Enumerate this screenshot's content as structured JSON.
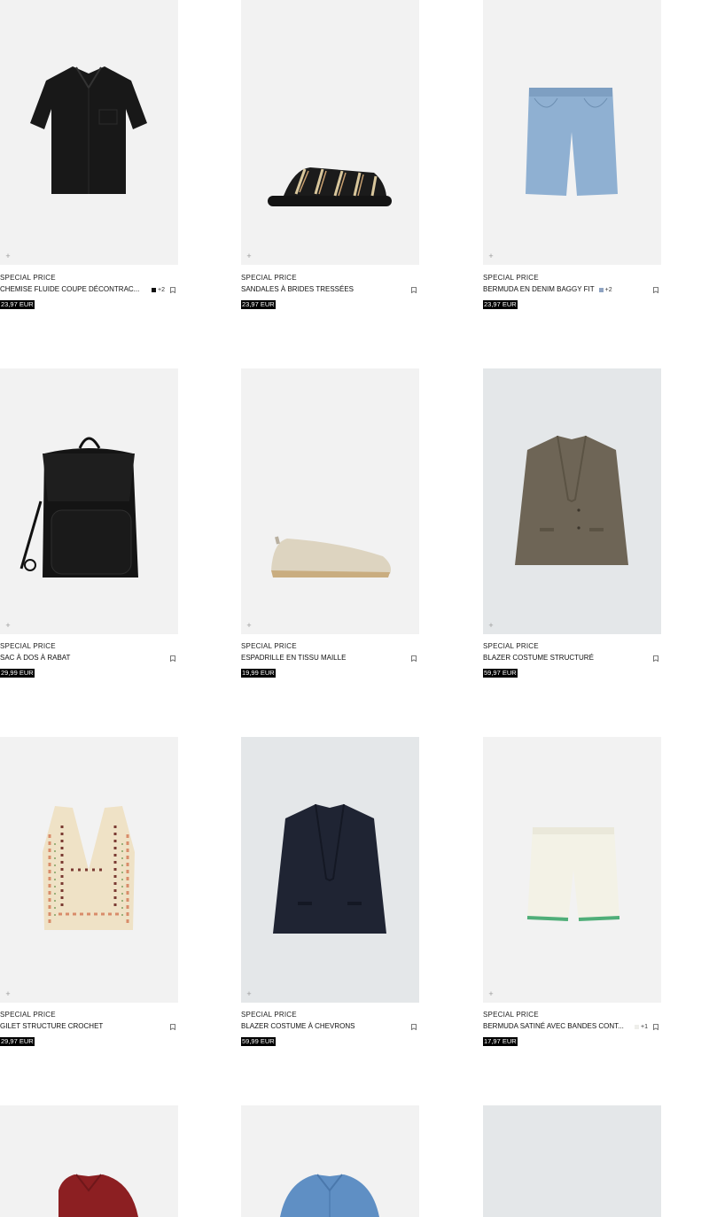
{
  "products": [
    {
      "tag": "SPECIAL PRICE",
      "name": "CHEMISE FLUIDE COUPE DÉCONTRAC...",
      "swatch_color": "#111111",
      "more": "+2",
      "price": "23,97 EUR",
      "icon": "black-shirt-icon",
      "bg": "#f2f2f2"
    },
    {
      "tag": "SPECIAL PRICE",
      "name": "SANDALES À BRIDES TRESSÉES",
      "swatch_color": "",
      "more": "",
      "price": "23,97 EUR",
      "icon": "woven-sandal-icon",
      "bg": "#f2f2f2"
    },
    {
      "tag": "SPECIAL PRICE",
      "name": "BERMUDA EN DENIM BAGGY FIT",
      "swatch_color": "#8ea3c2",
      "more": "+2",
      "price": "23,97 EUR",
      "icon": "denim-shorts-icon",
      "bg": "#f2f2f2"
    },
    {
      "tag": "SPECIAL PRICE",
      "name": "SAC À DOS À RABAT",
      "swatch_color": "",
      "more": "",
      "price": "29,99 EUR",
      "icon": "backpack-icon",
      "bg": "#f2f2f2"
    },
    {
      "tag": "SPECIAL PRICE",
      "name": "ESPADRILLE EN TISSU MAILLE",
      "swatch_color": "",
      "more": "",
      "price": "19,99 EUR",
      "icon": "espadrille-icon",
      "bg": "#f2f2f2"
    },
    {
      "tag": "SPECIAL PRICE",
      "name": "BLAZER COSTUME STRUCTURÉ",
      "swatch_color": "",
      "more": "",
      "price": "59,97 EUR",
      "icon": "brown-blazer-icon",
      "bg": "#e4e7e9"
    },
    {
      "tag": "SPECIAL PRICE",
      "name": "GILET STRUCTURE CROCHET",
      "swatch_color": "",
      "more": "",
      "price": "29,97 EUR",
      "icon": "crochet-vest-icon",
      "bg": "#f2f2f2"
    },
    {
      "tag": "SPECIAL PRICE",
      "name": "BLAZER COSTUME À CHEVRONS",
      "swatch_color": "",
      "more": "",
      "price": "59,99 EUR",
      "icon": "navy-blazer-icon",
      "bg": "#e4e7e9"
    },
    {
      "tag": "SPECIAL PRICE",
      "name": "BERMUDA SATINÉ AVEC BANDES CONT...",
      "swatch_color": "#eeeeea",
      "more": "+1",
      "price": "17,97 EUR",
      "icon": "satin-shorts-icon",
      "bg": "#f2f2f2"
    },
    {
      "tag": "",
      "name": "",
      "swatch_color": "",
      "more": "",
      "price": "",
      "icon": "red-polo-icon",
      "bg": "#f2f2f2"
    },
    {
      "tag": "",
      "name": "",
      "swatch_color": "",
      "more": "",
      "price": "",
      "icon": "blue-polo-icon",
      "bg": "#f2f2f2"
    },
    {
      "tag": "",
      "name": "",
      "swatch_color": "",
      "more": "",
      "price": "",
      "icon": "product-image-placeholder",
      "bg": "#e4e7e9"
    }
  ],
  "add_symbol": "+"
}
